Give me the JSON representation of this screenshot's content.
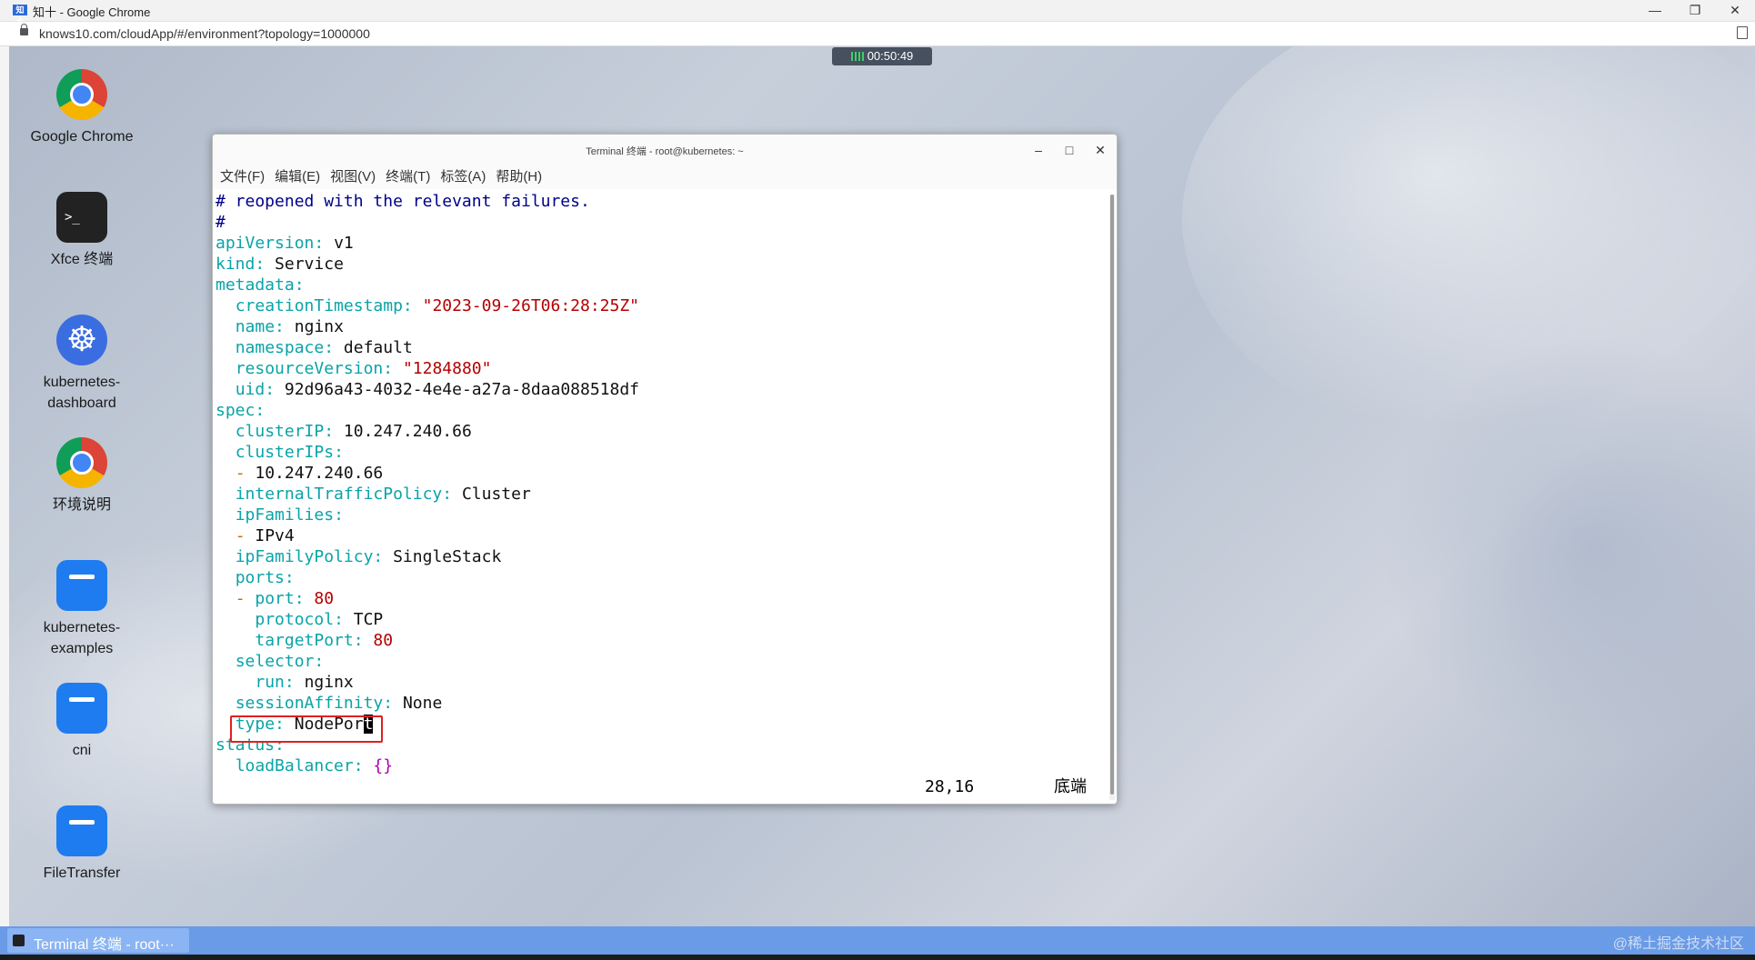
{
  "browser": {
    "window_title": "知十 - Google Chrome",
    "favicon_text": "知十",
    "url": "knows10.com/cloudApp/#/environment?topology=1000000",
    "timer": "00:50:49"
  },
  "desktop_icons": [
    {
      "label": "Google Chrome",
      "icon": "chrome-icon"
    },
    {
      "label": "Xfce 终端",
      "icon": "terminal-icon"
    },
    {
      "label": "kubernetes-\ndashboard",
      "icon": "kubernetes-icon"
    },
    {
      "label": "环境说明",
      "icon": "chrome-icon"
    },
    {
      "label": "kubernetes-\nexamples",
      "icon": "folder-icon"
    },
    {
      "label": "cni",
      "icon": "folder-icon"
    },
    {
      "label": "FileTransfer",
      "icon": "folder-icon"
    }
  ],
  "terminal": {
    "title": "Terminal 终端 - root@kubernetes: ~",
    "menu": [
      "文件(F)",
      "编辑(E)",
      "视图(V)",
      "终端(T)",
      "标签(A)",
      "帮助(H)"
    ],
    "lines": {
      "l1": "# reopened with the relevant failures.",
      "l2": "#",
      "l3k": "apiVersion",
      "l3v": "v1",
      "l4k": "kind",
      "l4v": "Service",
      "l5k": "metadata",
      "l6k": "creationTimestamp",
      "l6v": "\"2023-09-26T06:28:25Z\"",
      "l7k": "name",
      "l7v": "nginx",
      "l8k": "namespace",
      "l8v": "default",
      "l9k": "resourceVersion",
      "l9v": "\"1284880\"",
      "l10k": "uid",
      "l10v": "92d96a43-4032-4e4e-a27a-8daa088518df",
      "l11k": "spec",
      "l12k": "clusterIP",
      "l12v": "10.247.240.66",
      "l13k": "clusterIPs",
      "l14v": "10.247.240.66",
      "l15k": "internalTrafficPolicy",
      "l15v": "Cluster",
      "l16k": "ipFamilies",
      "l17v": "IPv4",
      "l18k": "ipFamilyPolicy",
      "l18v": "SingleStack",
      "l19k": "ports",
      "l20k": "port",
      "l20v": "80",
      "l21k": "protocol",
      "l21v": "TCP",
      "l22k": "targetPort",
      "l22v": "80",
      "l23k": "selector",
      "l24k": "run",
      "l24v": "nginx",
      "l25k": "sessionAffinity",
      "l25v": "None",
      "l26k": "type",
      "l26v": "NodePor",
      "l26cur": "t",
      "l27k": "status",
      "l28k": "loadBalancer",
      "l28v": "{}"
    },
    "status_position": "28,16",
    "status_mode": "底端"
  },
  "taskbar": {
    "item_label": "Terminal 终端 - root···",
    "watermark": "@稀土掘金技术社区"
  }
}
